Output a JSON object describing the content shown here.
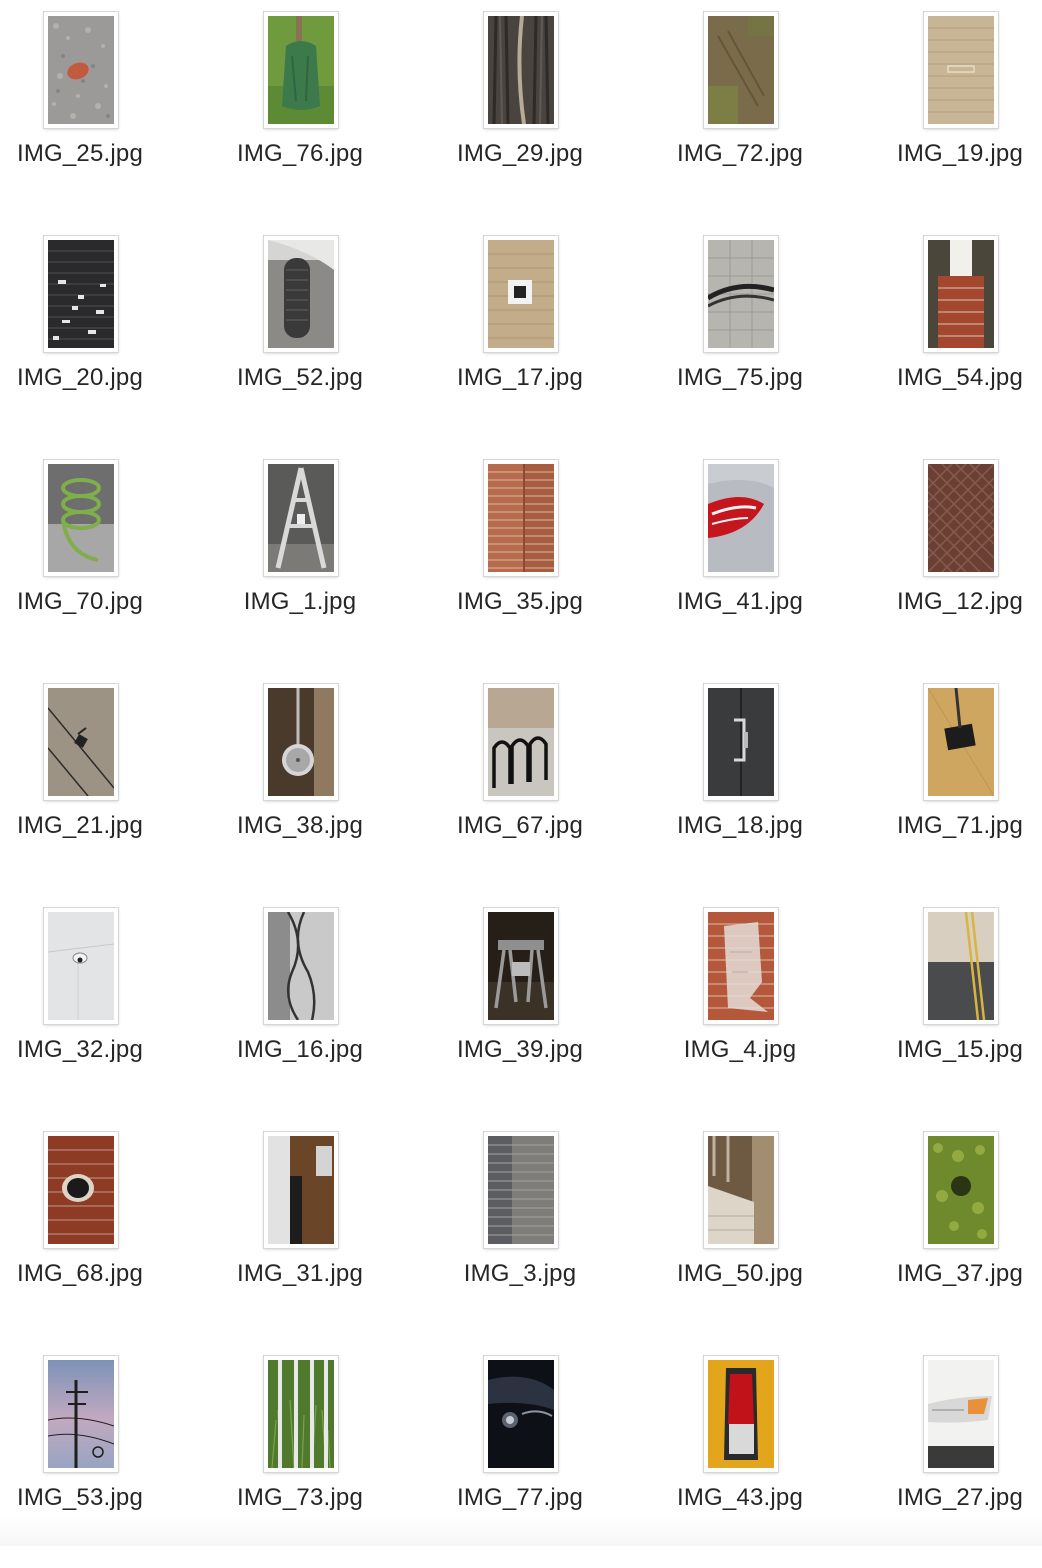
{
  "files": [
    {
      "name": "IMG_25.jpg",
      "icon": "gravel-with-red-stone-photo-icon"
    },
    {
      "name": "IMG_76.jpg",
      "icon": "green-bag-on-grass-photo-icon"
    },
    {
      "name": "IMG_29.jpg",
      "icon": "tree-bark-photo-icon"
    },
    {
      "name": "IMG_72.jpg",
      "icon": "dirt-ground-photo-icon"
    },
    {
      "name": "IMG_19.jpg",
      "icon": "tan-brick-wall-photo-icon"
    },
    {
      "name": "IMG_20.jpg",
      "icon": "dark-brick-wall-photo-icon"
    },
    {
      "name": "IMG_52.jpg",
      "icon": "car-tire-photo-icon"
    },
    {
      "name": "IMG_17.jpg",
      "icon": "wall-vent-photo-icon"
    },
    {
      "name": "IMG_75.jpg",
      "icon": "pavement-with-cable-photo-icon"
    },
    {
      "name": "IMG_54.jpg",
      "icon": "brick-pillar-photo-icon"
    },
    {
      "name": "IMG_70.jpg",
      "icon": "green-spiral-photo-icon"
    },
    {
      "name": "IMG_1.jpg",
      "icon": "ladder-a-frame-photo-icon"
    },
    {
      "name": "IMG_35.jpg",
      "icon": "brick-corner-photo-icon"
    },
    {
      "name": "IMG_41.jpg",
      "icon": "car-taillight-photo-icon"
    },
    {
      "name": "IMG_12.jpg",
      "icon": "diamond-plate-photo-icon"
    },
    {
      "name": "IMG_21.jpg",
      "icon": "concrete-lines-photo-icon"
    },
    {
      "name": "IMG_38.jpg",
      "icon": "round-mirror-photo-icon"
    },
    {
      "name": "IMG_67.jpg",
      "icon": "bike-rack-photo-icon"
    },
    {
      "name": "IMG_18.jpg",
      "icon": "door-handle-photo-icon"
    },
    {
      "name": "IMG_71.jpg",
      "icon": "floor-hole-photo-icon"
    },
    {
      "name": "IMG_32.jpg",
      "icon": "ceiling-camera-photo-icon"
    },
    {
      "name": "IMG_16.jpg",
      "icon": "hanging-chain-photo-icon"
    },
    {
      "name": "IMG_39.jpg",
      "icon": "sawhorse-photo-icon"
    },
    {
      "name": "IMG_4.jpg",
      "icon": "plastic-on-brick-photo-icon"
    },
    {
      "name": "IMG_15.jpg",
      "icon": "road-yellow-lines-photo-icon"
    },
    {
      "name": "IMG_68.jpg",
      "icon": "brick-hole-photo-icon"
    },
    {
      "name": "IMG_31.jpg",
      "icon": "door-frame-photo-icon"
    },
    {
      "name": "IMG_3.jpg",
      "icon": "stone-block-wall-photo-icon"
    },
    {
      "name": "IMG_50.jpg",
      "icon": "wooden-crate-photo-icon"
    },
    {
      "name": "IMG_37.jpg",
      "icon": "green-hedge-photo-icon"
    },
    {
      "name": "IMG_53.jpg",
      "icon": "power-lines-photo-icon"
    },
    {
      "name": "IMG_73.jpg",
      "icon": "fence-bars-grass-photo-icon"
    },
    {
      "name": "IMG_77.jpg",
      "icon": "dark-car-headlight-photo-icon"
    },
    {
      "name": "IMG_43.jpg",
      "icon": "yellow-taillight-photo-icon"
    },
    {
      "name": "IMG_27.jpg",
      "icon": "white-car-headlight-photo-icon"
    }
  ]
}
